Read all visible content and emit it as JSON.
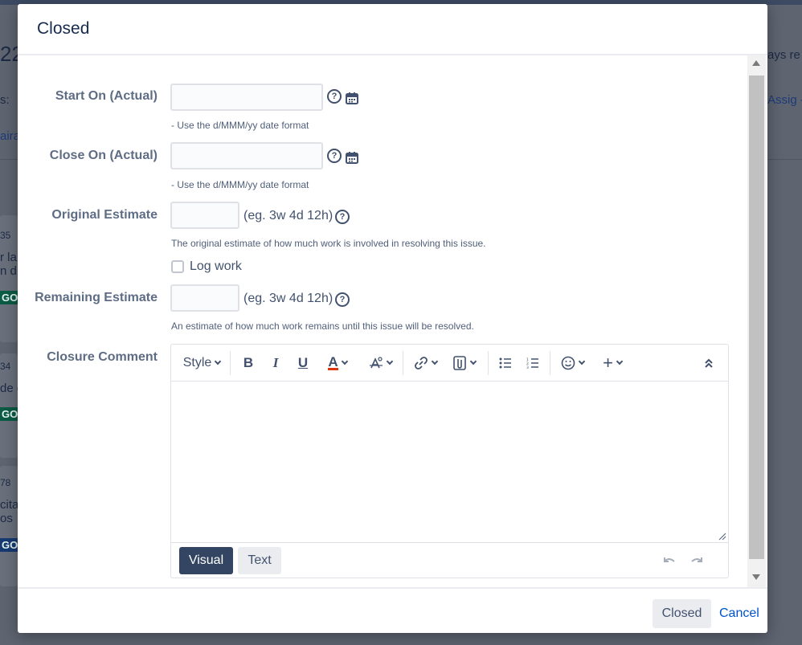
{
  "background": {
    "fragments": [
      "22",
      "s:",
      "aira",
      "35",
      "r la",
      "n d",
      "GO",
      "34",
      "de g",
      "GO",
      "78",
      "cita",
      "os",
      "GO",
      "ays re",
      "Assig -"
    ]
  },
  "dialog": {
    "title": "Closed",
    "fields": {
      "start_on": {
        "label": "Start On (Actual)",
        "value": "",
        "description": "- Use the d/MMM/yy date format"
      },
      "close_on": {
        "label": "Close On (Actual)",
        "value": "",
        "description": "- Use the d/MMM/yy date format"
      },
      "original_estimate": {
        "label": "Original Estimate",
        "value": "",
        "hint": "(eg. 3w 4d 12h)",
        "description": "The original estimate of how much work is involved in resolving this issue."
      },
      "log_work": {
        "label": "Log work",
        "checked": false
      },
      "remaining_estimate": {
        "label": "Remaining Estimate",
        "value": "",
        "hint": "(eg. 3w 4d 12h)",
        "description": "An estimate of how much work remains until this issue will be resolved."
      },
      "closure_comment": {
        "label": "Closure Comment",
        "value": ""
      }
    },
    "editor": {
      "style_label": "Style",
      "toolbar_icons": [
        "bold-icon",
        "italic-icon",
        "underline-icon",
        "text-color-icon",
        "text-format-icon",
        "link-icon",
        "attachment-icon",
        "bullet-list-icon",
        "numbered-list-icon",
        "emoji-icon",
        "insert-more-icon",
        "collapse-toolbar-icon"
      ],
      "mode_visual": "Visual",
      "mode_text": "Text"
    },
    "footer": {
      "submit_label": "Closed",
      "cancel_label": "Cancel"
    }
  },
  "colors": {
    "primary": "#0052cc",
    "visual_active": "#344563",
    "label": "#5e6c84",
    "overlay": "#5e6470"
  }
}
